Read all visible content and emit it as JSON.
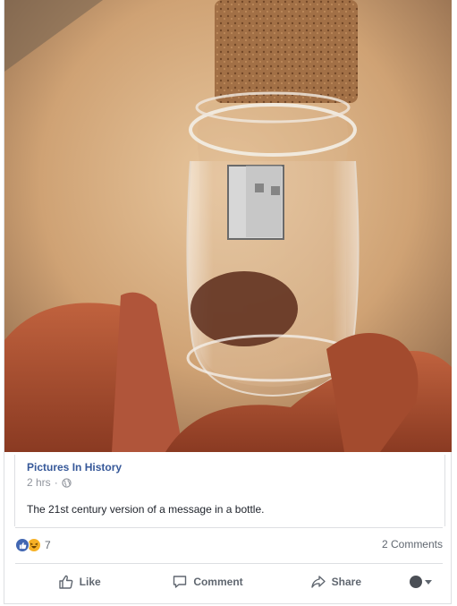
{
  "post": {
    "page_name": "Pictures In History",
    "timestamp": "2 hrs",
    "separator": "·",
    "privacy_icon": "globe-icon",
    "caption": "The 21st century version of a message in a bottle."
  },
  "photo": {
    "description_icon": "usb-bottle-photo"
  },
  "engagement": {
    "reaction_count": "7",
    "reaction_types": [
      "like",
      "haha"
    ],
    "comments_label": "2 Comments"
  },
  "actions": {
    "like_label": "Like",
    "comment_label": "Comment",
    "share_label": "Share"
  },
  "colors": {
    "link": "#365899",
    "muted": "#90949c",
    "action_text": "#606770",
    "like_blue": "#4267b2",
    "haha_yellow": "#f7b125",
    "border": "#dddfe2"
  }
}
